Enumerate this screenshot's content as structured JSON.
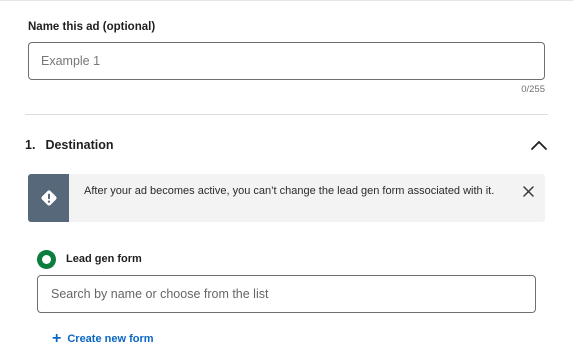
{
  "ad_name": {
    "label": "Name this ad (optional)",
    "value": "",
    "placeholder": "Example 1",
    "char_count": "0/255"
  },
  "destination": {
    "number": "1.",
    "title": "Destination",
    "alert": {
      "icon": "exclamation-diamond-icon",
      "message": "After your ad becomes active, you can’t change the lead gen form associated with it.",
      "close_icon": "close-icon"
    },
    "option": {
      "label": "Lead gen form",
      "selected": true
    },
    "search": {
      "value": "",
      "placeholder": "Search by name or choose from the list"
    },
    "create_link": {
      "icon": "plus-icon",
      "label": "Create new form"
    }
  },
  "colors": {
    "accent_blue": "#0a66c2",
    "radio_green": "#0b7d3e",
    "alert_icon_bg": "#56687a",
    "alert_bg": "#f3f3f3"
  }
}
